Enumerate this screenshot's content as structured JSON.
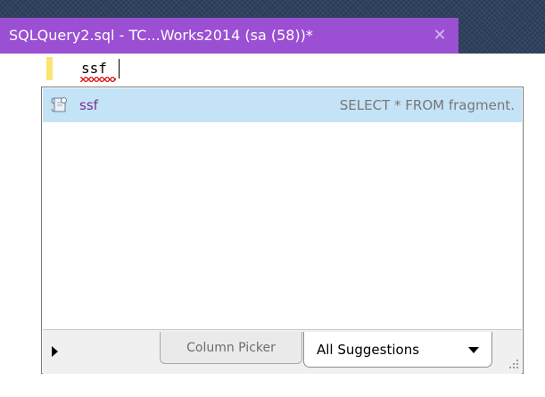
{
  "tab": {
    "title": "SQLQuery2.sql - TC...Works2014 (sa (58))*",
    "close_glyph": "✕"
  },
  "editor": {
    "typed_text": "ssf"
  },
  "completion": {
    "items": [
      {
        "label": "ssf",
        "description": "SELECT * FROM fragment.",
        "icon": "snippet-icon",
        "selected": true
      }
    ],
    "footer": {
      "tabs": [
        {
          "label": "Column Picker",
          "active": false
        },
        {
          "label": "All Suggestions",
          "active": true
        }
      ]
    }
  },
  "colors": {
    "tab_accent": "#9b4fd3",
    "selection": "#c5e3f7",
    "keyword_text": "#7b2f8f",
    "gutter_marker": "#fbe571"
  }
}
